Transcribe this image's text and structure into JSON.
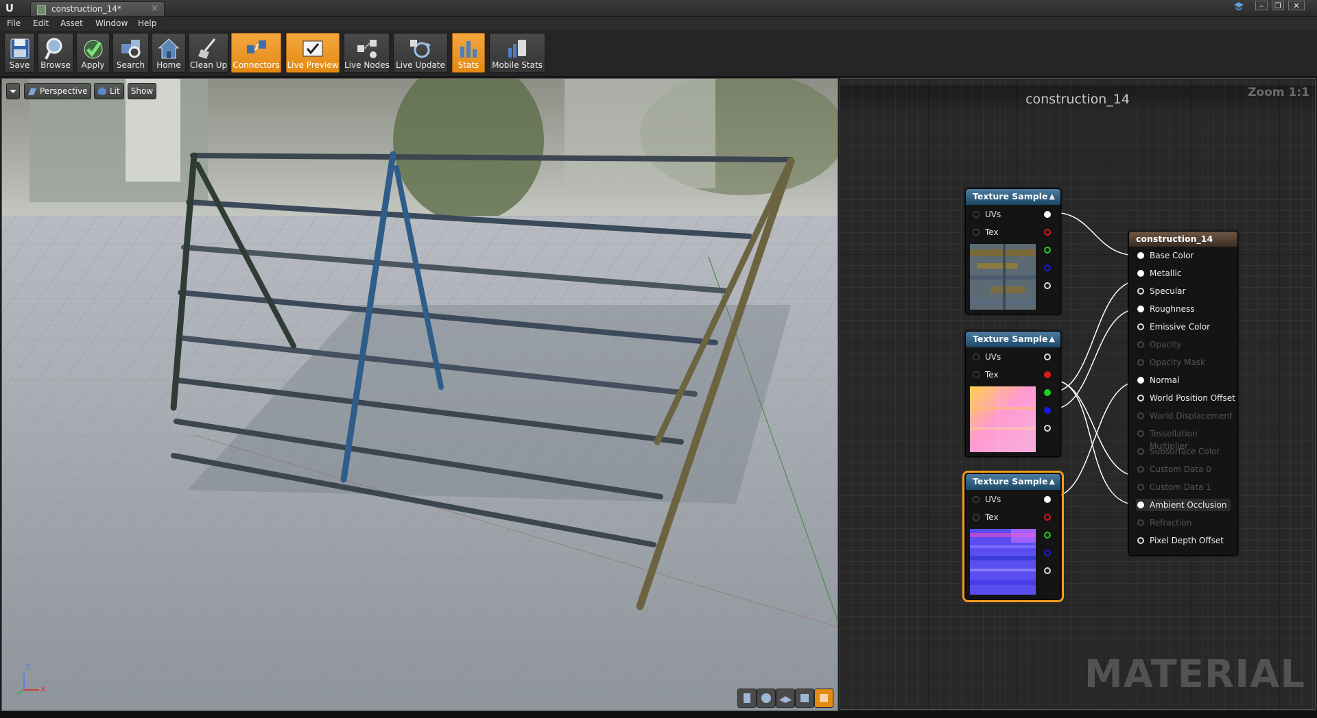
{
  "window": {
    "tab_title": "construction_14*",
    "tab_close": "×",
    "buttons": {
      "minimize": "–",
      "restore": "❐",
      "close": "✕"
    }
  },
  "menu": [
    {
      "id": "file",
      "label": "File"
    },
    {
      "id": "edit",
      "label": "Edit"
    },
    {
      "id": "asset",
      "label": "Asset"
    },
    {
      "id": "window",
      "label": "Window"
    },
    {
      "id": "help",
      "label": "Help"
    }
  ],
  "toolbar": [
    {
      "id": "save",
      "label": "Save",
      "icon": "save-icon",
      "active": false
    },
    {
      "id": "browse",
      "label": "Browse",
      "icon": "browse-icon",
      "active": false
    },
    {
      "id": "apply",
      "label": "Apply",
      "icon": "apply-icon",
      "active": false
    },
    {
      "id": "search",
      "label": "Search",
      "icon": "search-icon",
      "active": false
    },
    {
      "id": "home",
      "label": "Home",
      "icon": "home-icon",
      "active": false
    },
    {
      "id": "cleanup",
      "label": "Clean Up",
      "icon": "clean-up-icon",
      "active": false
    },
    {
      "id": "connectors",
      "label": "Connectors",
      "icon": "connectors-icon",
      "active": true
    },
    {
      "id": "livepreview",
      "label": "Live Preview",
      "icon": "live-preview-icon",
      "active": true
    },
    {
      "id": "livenodes",
      "label": "Live Nodes",
      "icon": "live-nodes-icon",
      "active": false
    },
    {
      "id": "liveupdate",
      "label": "Live Update",
      "icon": "live-update-icon",
      "active": false
    },
    {
      "id": "stats",
      "label": "Stats",
      "icon": "stats-icon",
      "active": true
    },
    {
      "id": "mobilestats",
      "label": "Mobile Stats",
      "icon": "mobile-stats-icon",
      "active": false
    }
  ],
  "viewport": {
    "perspective_label": "Perspective",
    "lit_label": "Lit",
    "show_label": "Show",
    "axis_z": "Z",
    "axis_x": "X"
  },
  "graph": {
    "title": "construction_14",
    "zoom": "Zoom 1:1",
    "watermark": "MATERIAL",
    "texture_nodes": [
      {
        "title": "Texture Sample",
        "collapse": "▲",
        "inputs": [
          "UVs",
          "Tex"
        ],
        "thumb": "base-color-texture",
        "selected": false
      },
      {
        "title": "Texture Sample",
        "collapse": "▲",
        "inputs": [
          "UVs",
          "Tex"
        ],
        "thumb": "packed-mask-texture",
        "selected": false
      },
      {
        "title": "Texture Sample",
        "collapse": "▲",
        "inputs": [
          "UVs",
          "Tex"
        ],
        "thumb": "normal-map-texture",
        "selected": true
      }
    ],
    "material_node": {
      "title": "construction_14",
      "pins": [
        {
          "label": "Base Color",
          "enabled": true,
          "connected": true
        },
        {
          "label": "Metallic",
          "enabled": true,
          "connected": true
        },
        {
          "label": "Specular",
          "enabled": true,
          "connected": false
        },
        {
          "label": "Roughness",
          "enabled": true,
          "connected": true
        },
        {
          "label": "Emissive Color",
          "enabled": true,
          "connected": false
        },
        {
          "label": "Opacity",
          "enabled": false,
          "connected": false
        },
        {
          "label": "Opacity Mask",
          "enabled": false,
          "connected": false
        },
        {
          "label": "Normal",
          "enabled": true,
          "connected": true
        },
        {
          "label": "World Position Offset",
          "enabled": true,
          "connected": false
        },
        {
          "label": "World Displacement",
          "enabled": false,
          "connected": false
        },
        {
          "label": "Tessellation Multiplier",
          "enabled": false,
          "connected": false
        },
        {
          "label": "Subsurface Color",
          "enabled": false,
          "connected": false
        },
        {
          "label": "Custom Data 0",
          "enabled": false,
          "connected": false
        },
        {
          "label": "Custom Data 1",
          "enabled": false,
          "connected": false
        },
        {
          "label": "Ambient Occlusion",
          "enabled": true,
          "connected": true
        },
        {
          "label": "Refraction",
          "enabled": false,
          "connected": false
        },
        {
          "label": "Pixel Depth Offset",
          "enabled": true,
          "connected": false
        }
      ]
    }
  },
  "colors": {
    "accent_orange": "#f29a1c",
    "pin_red": "#e01a1a",
    "pin_green": "#22d022",
    "pin_blue": "#1a1ae0",
    "pin_white": "#ffffff"
  }
}
